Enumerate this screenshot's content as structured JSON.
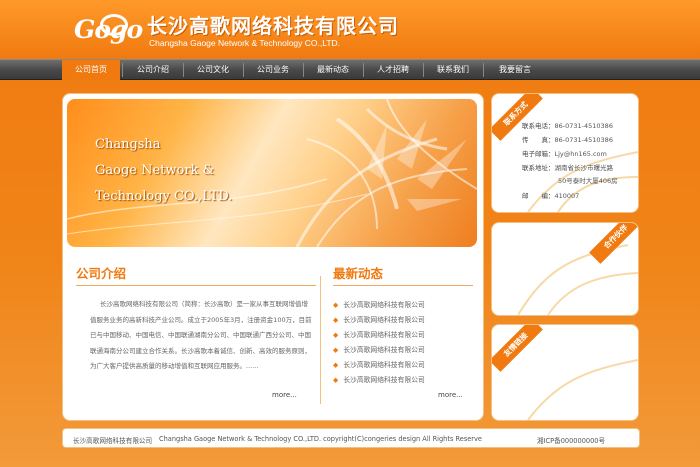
{
  "header": {
    "logo_text": "Gogo",
    "company_cn": "长沙高歌网络科技有限公司",
    "company_en": "Changsha Gaoge Network & Technology CO.,LTD."
  },
  "nav": {
    "items": [
      "公司首页",
      "公司介绍",
      "公司文化",
      "公司业务",
      "最新动态",
      "人才招聘",
      "联系我们",
      "我要留言"
    ],
    "active_index": 0
  },
  "banner": {
    "lines": [
      "Changsha",
      "Gaoge Network &",
      "Technology CO.,LTD."
    ]
  },
  "intro": {
    "title": "公司介绍",
    "text": "长沙高歌网络科技有限公司（简称：长沙高歌）是一家从事互联网增值增值服务业务的高新科技产业公司。成立于2005年3月，注册资金100万，目前已与中国移动、中国电信、中国联通湖南分公司、中国联通广西分公司、中国联通海南分公司建立合作关系。长沙高歌本着诚信、创新、高效的服务原则，为广大客户提供高质量的移动增值和互联网应用服务。......",
    "more": "more..."
  },
  "news": {
    "title": "最新动态",
    "items": [
      "长沙高歌网络科技有限公司",
      "长沙高歌网络科技有限公司",
      "长沙高歌网络科技有限公司",
      "长沙高歌网络科技有限公司",
      "长沙高歌网络科技有限公司",
      "长沙高歌网络科技有限公司"
    ],
    "more": "more..."
  },
  "sidebar": {
    "contact": {
      "ribbon": "联系方式",
      "rows": [
        {
          "label": "联系电话：",
          "value": "86-0731-4510386"
        },
        {
          "label": "传　　真：",
          "value": "86-0731-4510386"
        },
        {
          "label": "电子邮箱：",
          "value": "Ljy@hn165.com"
        },
        {
          "label": "联系地址：",
          "value": "湖南省长沙市曙光路"
        },
        {
          "label": "",
          "value": "50号泰时大厦406房"
        },
        {
          "label": "邮　　编：",
          "value": "410007"
        }
      ]
    },
    "partners": {
      "ribbon": "合作伙伴"
    },
    "links": {
      "ribbon": "友情链接"
    }
  },
  "footer": {
    "company": "长沙高歌网络科技有限公司",
    "copyright": "Changsha Gaoge Network & Technology CO.,LTD. copyright(C)congeries design All Rights Reserve",
    "icp": "湘ICP备000000000号"
  },
  "colors": {
    "accent": "#f07a10",
    "nav_bg": "#4a4a4a",
    "panel": "#ffffff"
  }
}
